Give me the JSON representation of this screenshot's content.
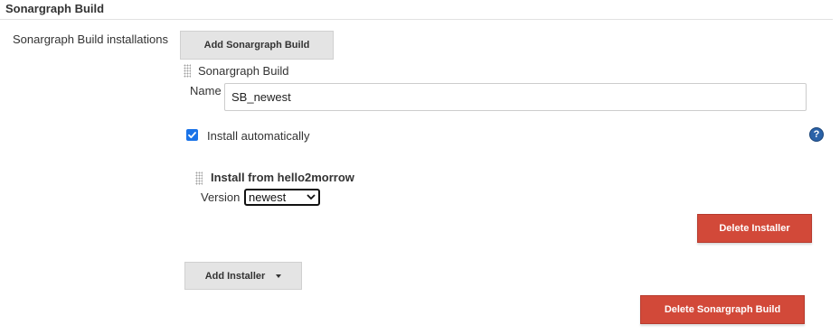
{
  "section": {
    "title": "Sonargraph Build"
  },
  "installations": {
    "label": "Sonargraph Build installations",
    "add_button": "Add Sonargraph Build",
    "item": {
      "header": "Sonargraph Build",
      "name_label": "Name",
      "name_value": "SB_newest",
      "install_auto_label": "Install automatically",
      "install_auto_checked": true,
      "help_icon": "question-circle-icon",
      "installer": {
        "header": "Install from hello2morrow",
        "version_label": "Version",
        "version_selected": "newest",
        "delete_button": "Delete Installer"
      },
      "add_installer_button": "Add Installer",
      "delete_button": "Delete Sonargraph Build"
    }
  },
  "colors": {
    "danger": "#d24939",
    "button_grey": "#e4e4e4",
    "checkbox": "#1a73e8",
    "help": "#2a62a8"
  }
}
